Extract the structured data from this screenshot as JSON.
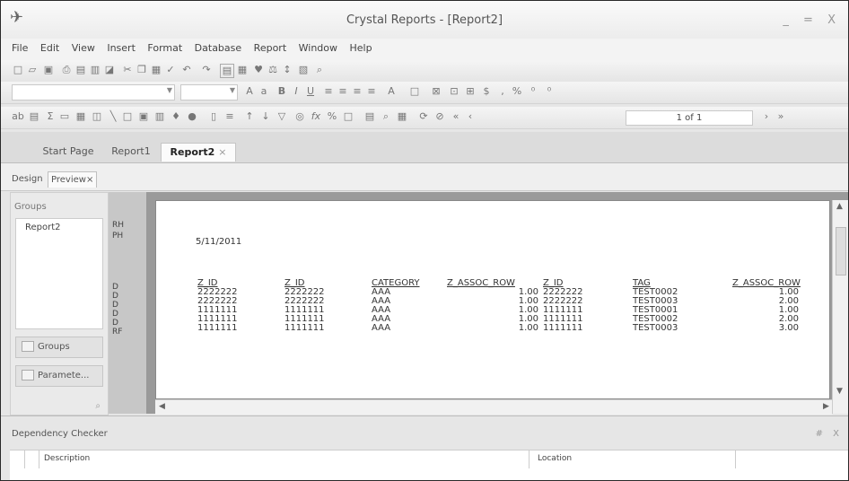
{
  "window": {
    "title": "Crystal Reports - [Report2]",
    "controls": "_ = X"
  },
  "menu": [
    {
      "label": "File"
    },
    {
      "label": "Edit"
    },
    {
      "label": "View"
    },
    {
      "label": "Insert"
    },
    {
      "label": "Format"
    },
    {
      "label": "Database"
    },
    {
      "label": "Report"
    },
    {
      "label": "Window"
    },
    {
      "label": "Help"
    }
  ],
  "navigation": {
    "page_indicator": "1 of 1"
  },
  "doc_tabs": {
    "start_page": "Start Page",
    "report1": "Report1",
    "report2": "Report2",
    "close": "×"
  },
  "view_tabs": {
    "design": "Design",
    "preview": "Preview",
    "close": "×"
  },
  "left_panel": {
    "header": "Groups",
    "tree_item": "Report2",
    "groups_button": "Groups",
    "parameters_button": "Paramete..."
  },
  "sections": [
    "RH",
    "PH",
    "D",
    "D",
    "D",
    "D",
    "D",
    "RF"
  ],
  "report": {
    "date": "5/11/2011",
    "columns": [
      "Z_ID",
      "Z_ID",
      "CATEGORY",
      "Z_ASSOC_ROW",
      "Z_ID",
      "TAG",
      "Z_ASSOC_ROW"
    ],
    "rows": [
      [
        "2222222",
        "2222222",
        "AAA",
        "1.00",
        "2222222",
        "TEST0002",
        "1.00"
      ],
      [
        "2222222",
        "2222222",
        "AAA",
        "1.00",
        "2222222",
        "TEST0003",
        "2.00"
      ],
      [
        "1111111",
        "1111111",
        "AAA",
        "1.00",
        "1111111",
        "TEST0001",
        "1.00"
      ],
      [
        "1111111",
        "1111111",
        "AAA",
        "1.00",
        "1111111",
        "TEST0002",
        "2.00"
      ],
      [
        "1111111",
        "1111111",
        "AAA",
        "1.00",
        "1111111",
        "TEST0003",
        "3.00"
      ]
    ]
  },
  "dependency_checker": {
    "title": "Dependency Checker",
    "pins": "# X",
    "columns": {
      "description": "Description",
      "location": "Location"
    }
  },
  "icons": {
    "app": "crystal-reports-logo-icon",
    "toolbar": [
      "new-icon",
      "open-icon",
      "save-icon",
      "print-icon",
      "preview-icon",
      "export-icon",
      "cut-icon",
      "copy-icon",
      "paste-icon",
      "undo-icon",
      "redo-icon",
      "field-explorer-icon",
      "report-explorer-icon",
      "sort-icon",
      "search-icon",
      "bold-icon",
      "italic-icon",
      "underline-icon",
      "align-left-icon",
      "align-center-icon",
      "align-right-icon",
      "justify-icon",
      "font-color-icon",
      "border-icon",
      "insert-text-icon",
      "insert-group-icon",
      "insert-summary-icon",
      "insert-chart-icon",
      "insert-line-icon",
      "insert-box-icon",
      "insert-picture-icon",
      "refresh-icon",
      "stop-icon",
      "first-page-icon",
      "prev-page-icon",
      "next-page-icon",
      "last-page-icon"
    ]
  }
}
